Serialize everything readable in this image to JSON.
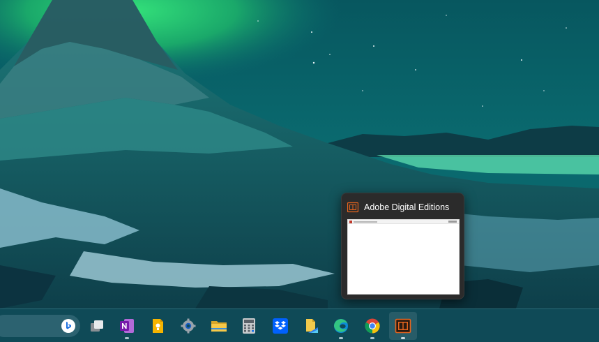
{
  "preview": {
    "title": "Adobe Digital Editions"
  },
  "taskbar": {
    "items": [
      {
        "icon": "bing-search-icon"
      },
      {
        "icon": "task-view-icon"
      },
      {
        "icon": "onenote-icon"
      },
      {
        "icon": "google-keep-icon"
      },
      {
        "icon": "settings-gear-icon"
      },
      {
        "icon": "file-explorer-icon"
      },
      {
        "icon": "calculator-icon"
      },
      {
        "icon": "dropbox-icon"
      },
      {
        "icon": "file-shortcut-icon"
      },
      {
        "icon": "edge-icon"
      },
      {
        "icon": "chrome-icon"
      },
      {
        "icon": "adobe-digital-editions-icon"
      }
    ]
  },
  "colors": {
    "taskbar_bg": "#0f4a57",
    "preview_bg": "#2b2b2b",
    "adobe_orange": "#e8651e"
  }
}
